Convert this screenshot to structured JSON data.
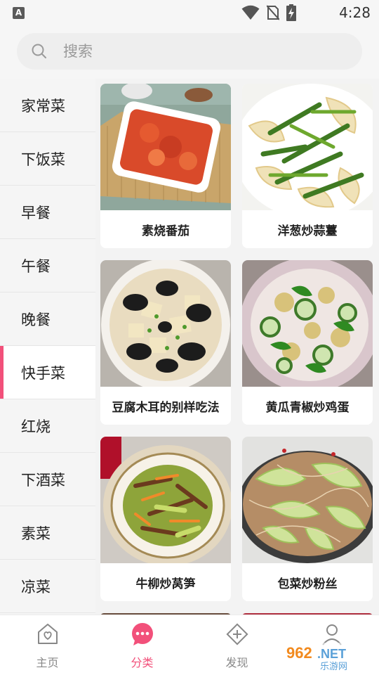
{
  "status_bar": {
    "notification_icon": "A",
    "time": "4:28",
    "icons": [
      "wifi-icon",
      "no-sim-icon",
      "battery-charging-icon"
    ]
  },
  "search": {
    "placeholder": "搜索",
    "icon": "search-icon"
  },
  "sidebar": {
    "active_index": 5,
    "items": [
      {
        "label": "家常菜"
      },
      {
        "label": "下饭菜"
      },
      {
        "label": "早餐"
      },
      {
        "label": "午餐"
      },
      {
        "label": "晚餐"
      },
      {
        "label": "快手菜"
      },
      {
        "label": "红烧"
      },
      {
        "label": "下酒菜"
      },
      {
        "label": "素菜"
      },
      {
        "label": "凉菜"
      }
    ]
  },
  "recipes": [
    {
      "title": "素烧番茄"
    },
    {
      "title": "洋葱炒蒜薹"
    },
    {
      "title": "豆腐木耳的别样吃法"
    },
    {
      "title": "黄瓜青椒炒鸡蛋"
    },
    {
      "title": "牛柳炒莴笋"
    },
    {
      "title": "包菜炒粉丝"
    }
  ],
  "bottom_nav": {
    "active_index": 1,
    "items": [
      {
        "label": "主页",
        "icon": "home-heart-icon"
      },
      {
        "label": "分类",
        "icon": "chat-dots-icon"
      },
      {
        "label": "发现",
        "icon": "compass-plus-icon"
      },
      {
        "label": "",
        "icon": "person-icon"
      }
    ]
  },
  "watermark": {
    "text": "962.NET 乐游网"
  },
  "colors": {
    "accent": "#f2507a",
    "sidebar_bg": "#f5f5f5",
    "content_bg": "#f3f3f3"
  }
}
